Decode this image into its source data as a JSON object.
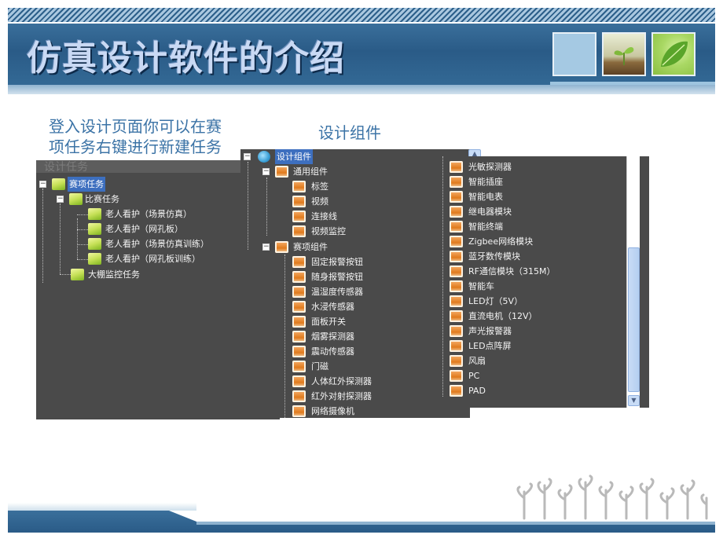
{
  "slide": {
    "title": "仿真设计软件的介绍",
    "caption_left_line1": "登入设计页面你可以在赛",
    "caption_left_line2": "项任务右键进行新建任务",
    "caption_right": "设计组件"
  },
  "task_tree": {
    "header_fragment": "设计任务",
    "root": "赛项任务",
    "group": "比赛任务",
    "items": [
      "老人看护（场景仿真）",
      "老人看护（网孔板）",
      "老人看护（场景仿真训练）",
      "老人看护（网孔板训练）"
    ],
    "other": "大棚监控任务"
  },
  "component_tree": {
    "root": "设计组件",
    "general_group": "通用组件",
    "general_items": [
      "标签",
      "视频",
      "连接线",
      "视频监控"
    ],
    "competition_group": "赛项组件",
    "competition_items": [
      "固定报警按钮",
      "随身报警按钮",
      "温湿度传感器",
      "水浸传感器",
      "面板开关",
      "烟雾探测器",
      "震动传感器",
      "门磁",
      "人体红外探测器",
      "红外对射探测器",
      "网络摄像机"
    ]
  },
  "component_list_right": [
    "光敏探测器",
    "智能插座",
    "智能电表",
    "继电器模块",
    "智能终端",
    "Zigbee网络模块",
    "蓝牙数传模块",
    "RF通信模块（315M）",
    "智能车",
    "LED灯（5V）",
    "直流电机（12V）",
    "声光报警器",
    "LED点阵屏",
    "风扇",
    "PC",
    "PAD"
  ],
  "icons": {
    "folder": "folder-icon",
    "component": "component-icon",
    "root_component": "globe-icon",
    "expand": "minus-box-icon"
  },
  "colors": {
    "header_blue": "#2a5b87",
    "title_text": "#c9d9f4",
    "caption_text": "#3b73a6",
    "panel_bg": "#4a4a4a",
    "selection": "#3d6fbf"
  }
}
